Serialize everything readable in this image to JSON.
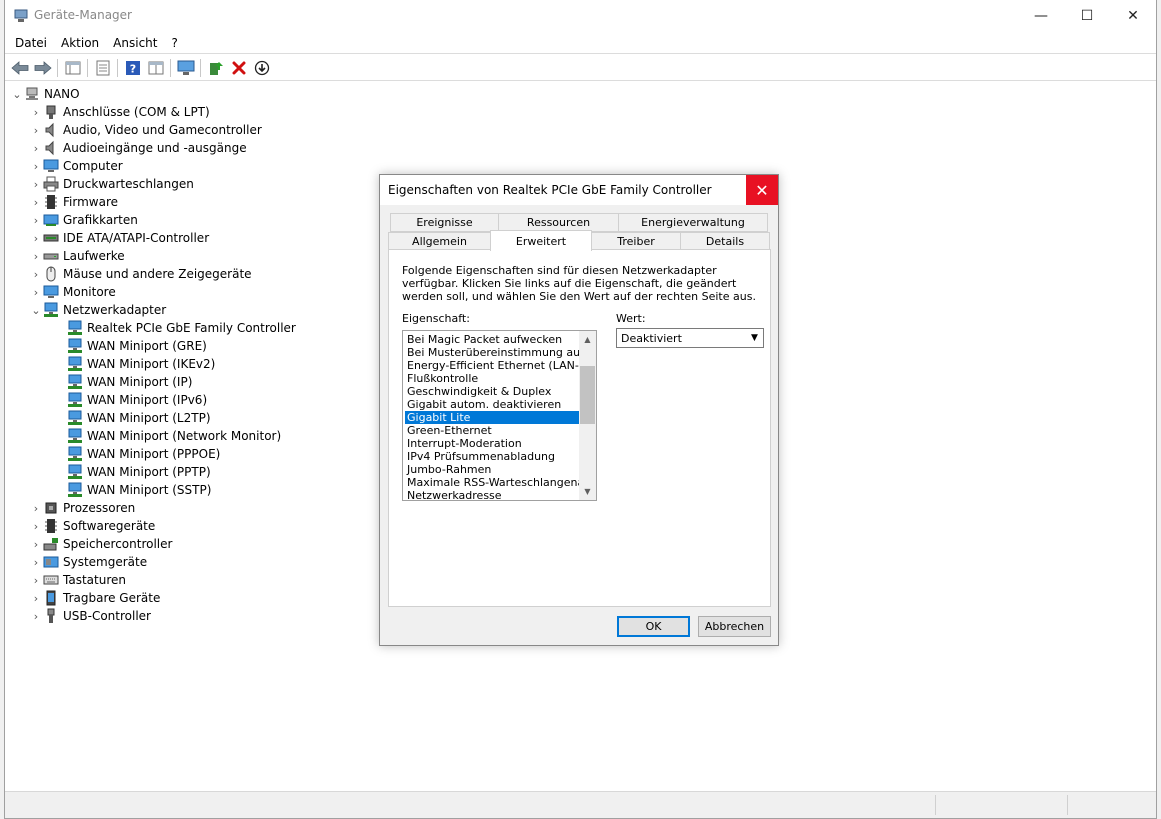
{
  "window": {
    "title": "Geräte-Manager",
    "controls": {
      "minimize": "—",
      "maximize": "☐",
      "close": "✕"
    }
  },
  "menu": [
    "Datei",
    "Aktion",
    "Ansicht",
    "?"
  ],
  "toolbar": {
    "buttons": [
      "back-arrow-icon",
      "forward-arrow-icon",
      "console-tree-icon",
      "properties-icon",
      "help-icon",
      "view-icon",
      "monitor-scan-icon",
      "update-driver-icon",
      "uninstall-icon",
      "disable-icon"
    ]
  },
  "tree": {
    "root": "NANO",
    "categories": [
      "Anschlüsse (COM & LPT)",
      "Audio, Video und Gamecontroller",
      "Audioeingänge und -ausgänge",
      "Computer",
      "Druckwarteschlangen",
      "Firmware",
      "Grafikkarten",
      "IDE ATA/ATAPI-Controller",
      "Laufwerke",
      "Mäuse und andere Zeigegeräte",
      "Monitore",
      "Netzwerkadapter"
    ],
    "network_adapters": [
      "Realtek PCIe GbE Family Controller",
      "WAN Miniport (GRE)",
      "WAN Miniport (IKEv2)",
      "WAN Miniport (IP)",
      "WAN Miniport (IPv6)",
      "WAN Miniport (L2TP)",
      "WAN Miniport (Network Monitor)",
      "WAN Miniport (PPPOE)",
      "WAN Miniport (PPTP)",
      "WAN Miniport (SSTP)"
    ],
    "categories_after": [
      "Prozessoren",
      "Softwaregeräte",
      "Speichercontroller",
      "Systemgeräte",
      "Tastaturen",
      "Tragbare Geräte",
      "USB-Controller"
    ]
  },
  "dialog": {
    "title": "Eigenschaften von Realtek PCIe GbE Family Controller",
    "close": "✕",
    "tabs_top": [
      "Ereignisse",
      "Ressourcen",
      "Energieverwaltung"
    ],
    "tabs_bottom": [
      "Allgemein",
      "Erweitert",
      "Treiber",
      "Details"
    ],
    "active_tab": "Erweitert",
    "description": "Folgende Eigenschaften sind für diesen Netzwerkadapter verfügbar. Klicken Sie links auf die Eigenschaft, die geändert werden soll, und wählen Sie den Wert auf der rechten Seite aus.",
    "property_label": "Eigenschaft:",
    "value_label": "Wert:",
    "properties": [
      "Bei Magic Packet aufwecken",
      "Bei Musterübereinstimmung aufwecken",
      "Energy-Efficient Ethernet (LAN-Energie)",
      "Flußkontrolle",
      "Geschwindigkeit & Duplex",
      "Gigabit autom. deaktivieren",
      "Gigabit Lite",
      "Green-Ethernet",
      "Interrupt-Moderation",
      "IPv4 Prüfsummenabladung",
      "Jumbo-Rahmen",
      "Maximale RSS-Warteschlangenanzahl",
      "Netzwerkadresse"
    ],
    "selected_property": "Gigabit Lite",
    "value": "Deaktiviert",
    "ok_label": "OK",
    "cancel_label": "Abbrechen"
  }
}
